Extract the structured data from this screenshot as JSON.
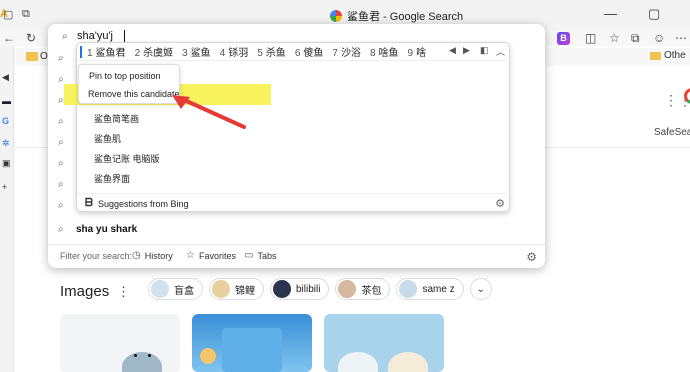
{
  "browser": {
    "tab_title": "鲨鱼君 - Google Search",
    "favorites_other": "Othe",
    "favorites_left_initial": "Ot",
    "extension_badge": "B",
    "rail_initial": "A"
  },
  "omnibox": {
    "input_value": "sha'yu'j",
    "suggestions": [
      {
        "text": "sha yu shark"
      }
    ],
    "filter_label": "Filter your search:",
    "filter_history": "History",
    "filter_favorites": "Favorites",
    "filter_tabs": "Tabs"
  },
  "ime": {
    "candidates": [
      {
        "num": "1",
        "text": "鲨鱼君"
      },
      {
        "num": "2",
        "text": "杀虞姬"
      },
      {
        "num": "3",
        "text": "鲨鱼"
      },
      {
        "num": "4",
        "text": "铩羽"
      },
      {
        "num": "5",
        "text": "杀鱼"
      },
      {
        "num": "6",
        "text": "傻鱼"
      },
      {
        "num": "7",
        "text": "沙浴"
      },
      {
        "num": "8",
        "text": "啥鱼"
      },
      {
        "num": "9",
        "text": "啥"
      }
    ],
    "list_items": [
      "鲨鱼简笔画",
      "鲨鱼肌",
      "鲨鱼记账 电脑版",
      "鲨鱼界面"
    ],
    "bing_label": "Suggestions from Bing"
  },
  "context_menu": {
    "pin": "Pin to top position",
    "remove": "Remove this candidate"
  },
  "page": {
    "safesearch": "SafeSearch",
    "images_heading": "Images",
    "chips": [
      "盲盒",
      "锦鲤",
      "bilibili",
      "茶包",
      "same z"
    ]
  },
  "colors": {
    "highlight": "#f7f14b",
    "arrow": "#e53935",
    "accent": "#1a73e8"
  }
}
